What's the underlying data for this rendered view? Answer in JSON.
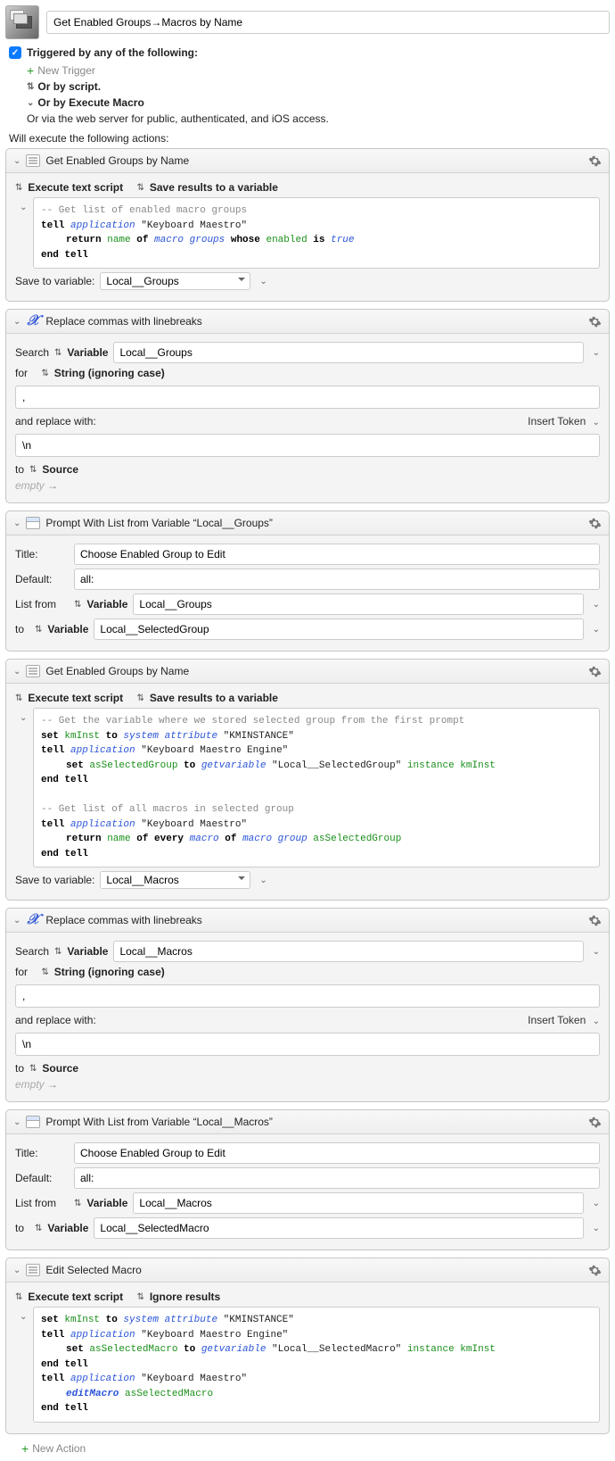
{
  "macro_name": "Get Enabled Groups→Macros by Name",
  "trigger": {
    "header": "Triggered by any of the following:",
    "new_trigger": "New Trigger",
    "or_script": "Or by script.",
    "or_execute": "Or by Execute Macro",
    "or_web": "Or via the web server for public, authenticated, and iOS access."
  },
  "execute_label": "Will execute the following actions:",
  "actions": [
    {
      "title": "Get Enabled Groups by Name",
      "opt1": "Execute text script",
      "opt2": "Save results to a variable",
      "script": {
        "l1_cmt": "-- Get list of enabled macro groups",
        "l2_tell": "tell",
        "l2_app": "application",
        "l2_str": " \"Keyboard Maestro\"",
        "l3_ret": "return",
        "l3_name": "name",
        "l3_of": " of ",
        "l3_mg": "macro groups",
        "l3_whose": " whose ",
        "l3_en": "enabled",
        "l3_is": " is ",
        "l3_true": "true",
        "l4": "end tell"
      },
      "save_label": "Save to variable:",
      "save_value": "Local__Groups"
    },
    {
      "title": "Replace commas with linebreaks",
      "search_label": "Search",
      "variable": "Variable",
      "var_value": "Local__Groups",
      "for_label": "for",
      "for_mode": "String (ignoring case)",
      "for_value": ",",
      "replace_label": "and replace with:",
      "insert_token": "Insert Token",
      "replace_value": "\\n",
      "to_label": "to",
      "to_mode": "Source",
      "empty": "empty"
    },
    {
      "title": "Prompt With List from Variable “Local__Groups”",
      "title_label": "Title:",
      "title_value": "Choose Enabled Group to Edit",
      "default_label": "Default:",
      "default_value": "all:",
      "listfrom_label": "List from",
      "listfrom_mode": "Variable",
      "listfrom_value": "Local__Groups",
      "to_label": "to",
      "to_mode": "Variable",
      "to_value": "Local__SelectedGroup"
    },
    {
      "title": "Get Enabled Groups by Name",
      "opt1": "Execute text script",
      "opt2": "Save results to a variable",
      "script": {
        "l1_cmt": "-- Get the variable where we stored selected group from the first prompt",
        "l2_set": "set",
        "l2_km": " kmInst ",
        "l2_to": "to",
        "l2_sys": " system attribute",
        "l2_str": " \"KMINSTANCE\"",
        "l3_tell": "tell",
        "l3_app": "application",
        "l3_str": " \"Keyboard Maestro Engine\"",
        "l4_set": "set",
        "l4_as": " asSelectedGroup ",
        "l4_to": "to",
        "l4_gv": " getvariable",
        "l4_str": " \"Local__SelectedGroup\" ",
        "l4_inst": "instance",
        "l4_km": " kmInst",
        "l5": "end tell",
        "l7_cmt": "-- Get list of all macros in selected group",
        "l8_tell": "tell",
        "l8_app": "application",
        "l8_str": " \"Keyboard Maestro\"",
        "l9_ret": "return",
        "l9_name": " name",
        "l9_of1": " of every",
        "l9_macro": " macro",
        "l9_of2": " of",
        "l9_mg": " macro group",
        "l9_as": " asSelectedGroup",
        "l10": "end tell"
      },
      "save_label": "Save to variable:",
      "save_value": "Local__Macros"
    },
    {
      "title": "Replace commas with linebreaks",
      "search_label": "Search",
      "variable": "Variable",
      "var_value": "Local__Macros",
      "for_label": "for",
      "for_mode": "String (ignoring case)",
      "for_value": ",",
      "replace_label": "and replace with:",
      "insert_token": "Insert Token",
      "replace_value": "\\n",
      "to_label": "to",
      "to_mode": "Source",
      "empty": "empty"
    },
    {
      "title": "Prompt With List from Variable “Local__Macros”",
      "title_label": "Title:",
      "title_value": "Choose Enabled Group to Edit",
      "default_label": "Default:",
      "default_value": "all:",
      "listfrom_label": "List from",
      "listfrom_mode": "Variable",
      "listfrom_value": "Local__Macros",
      "to_label": "to",
      "to_mode": "Variable",
      "to_value": "Local__SelectedMacro"
    },
    {
      "title": "Edit Selected Macro",
      "opt1": "Execute text script",
      "opt2": "Ignore results",
      "script": {
        "l1_set": "set",
        "l1_km": " kmInst ",
        "l1_to": "to",
        "l1_sys": " system attribute",
        "l1_str": " \"KMINSTANCE\"",
        "l2_tell": "tell",
        "l2_app": "application",
        "l2_str": " \"Keyboard Maestro Engine\"",
        "l3_set": "set",
        "l3_as": " asSelectedMacro ",
        "l3_to": "to",
        "l3_gv": " getvariable",
        "l3_str": " \"Local__SelectedMacro\" ",
        "l3_inst": "instance",
        "l3_km": " kmInst",
        "l4": "end tell",
        "l5_tell": "tell",
        "l5_app": "application",
        "l5_str": " \"Keyboard Maestro\"",
        "l6_em": "editMacro",
        "l6_as": " asSelectedMacro",
        "l7": "end tell"
      }
    }
  ],
  "new_action": "New Action"
}
